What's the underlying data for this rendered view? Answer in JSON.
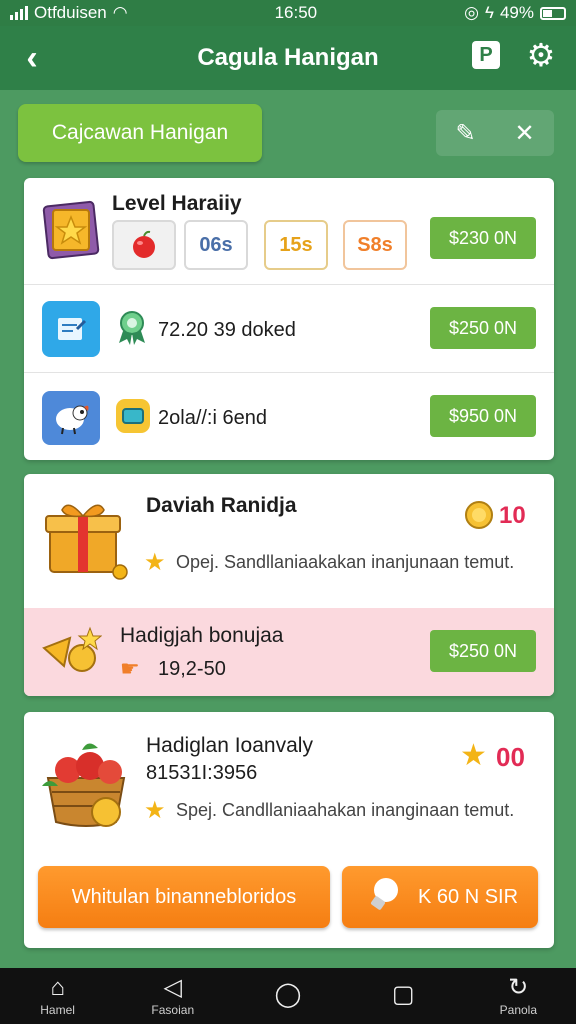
{
  "status_bar": {
    "carrier": "Otfduisen",
    "time": "16:50",
    "battery": "49%"
  },
  "app_bar": {
    "title": "Cagula Hanigan",
    "square_icon_text": "P"
  },
  "header": {
    "tab_label": "Cajcawan Hanigan"
  },
  "colors": {
    "primary_green": "#2f8048",
    "price_green": "#6cb443",
    "accent_orange": "#f57e12",
    "pink_row": "#fbd9de",
    "badge_red": "#e22b55"
  },
  "card1": {
    "title": "Level Haraiiy",
    "chips": [
      "06s",
      "15s",
      "S8s"
    ],
    "rows": [
      {
        "price": "$230 0N"
      },
      {
        "text": "72.20 39 doked",
        "price": "$250 0N"
      },
      {
        "text": "2ola//:i 6end",
        "price": "$950 0N"
      }
    ]
  },
  "card2": {
    "title": "Daviah Ranidja",
    "coin_count": "10",
    "desc": "Opej. Sandllaniaakakan inanjunaan temut.",
    "bonus_title": "Hadigjah bonujaa",
    "bonus_value": "19,2-50",
    "bonus_price": "$250 0N"
  },
  "card3": {
    "title": "Hadiglan Ioanvaly",
    "code": "81531I:3956",
    "desc": "Spej. Candllaniaahakan inanginaan temut.",
    "count": "00",
    "primary_button": "Whitulan binannebloridos",
    "secondary_button": "K 60 N SIR"
  },
  "bottom_nav": {
    "items": [
      "Hamel",
      "Fasoian",
      "",
      "",
      "Panola"
    ]
  }
}
